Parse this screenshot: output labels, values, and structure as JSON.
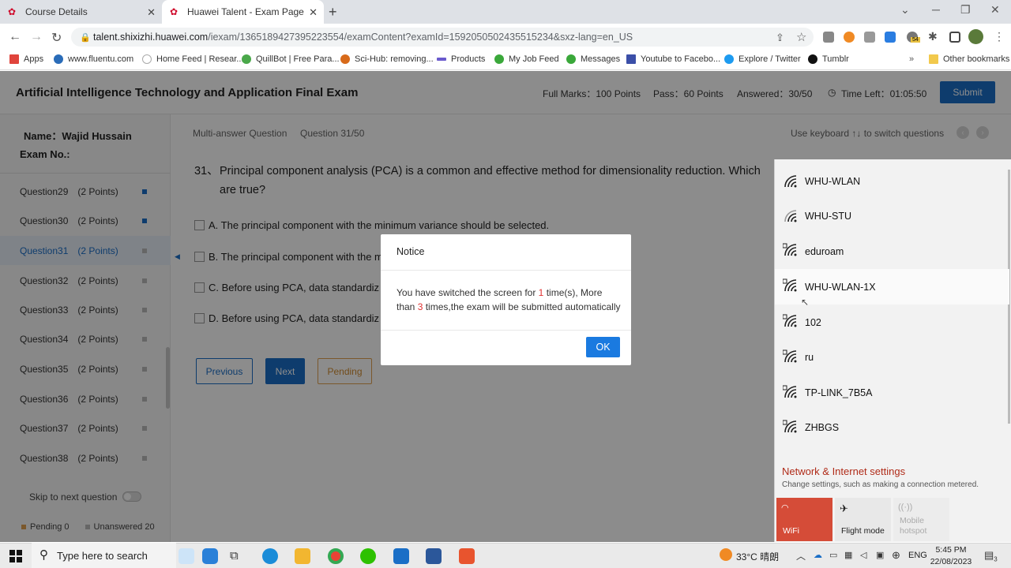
{
  "browser": {
    "tabs": [
      {
        "label": "Course Details",
        "active": false
      },
      {
        "label": "Huawei Talent - Exam Page",
        "active": true
      }
    ],
    "url_host": "talent.shixizhi.huawei.com",
    "url_path": "/iexam/1365189427395223554/examContent?examId=1592050502435515234&sxz-lang=en_US",
    "bookmarks": [
      "Apps",
      "www.fluentu.com",
      "Home Feed | Resear...",
      "QuillBot | Free Para...",
      "Sci-Hub: removing...",
      "Products",
      "My Job Feed",
      "Messages",
      "Youtube to Facebo...",
      "Explore / Twitter",
      "Tumblr",
      "Other bookmarks"
    ],
    "ext_badge": "54"
  },
  "exam": {
    "title": "Artificial Intelligence Technology and Application Final Exam",
    "full_marks": "Full Marks：100 Points",
    "pass": "Pass：60 Points",
    "answered": "Answered：30/50",
    "time_left": "Time Left：01:05:50",
    "submit": "Submit"
  },
  "sidebar": {
    "name": "Name：Wajid Hussain",
    "exam_no": "Exam No.:",
    "questions": [
      {
        "label": "Question29",
        "points": "(2 Points)",
        "answered": true
      },
      {
        "label": "Question30",
        "points": "(2 Points)",
        "answered": true
      },
      {
        "label": "Question31",
        "points": "(2 Points)",
        "answered": false
      },
      {
        "label": "Question32",
        "points": "(2 Points)",
        "answered": false
      },
      {
        "label": "Question33",
        "points": "(2 Points)",
        "answered": false
      },
      {
        "label": "Question34",
        "points": "(2 Points)",
        "answered": false
      },
      {
        "label": "Question35",
        "points": "(2 Points)",
        "answered": false
      },
      {
        "label": "Question36",
        "points": "(2 Points)",
        "answered": false
      },
      {
        "label": "Question37",
        "points": "(2 Points)",
        "answered": false
      },
      {
        "label": "Question38",
        "points": "(2 Points)",
        "answered": false
      }
    ],
    "skip_label": "Skip to next question",
    "pending": "Pending 0",
    "unanswered": "Unanswered 20"
  },
  "question": {
    "type": "Multi-answer Question",
    "number": "Question 31/50",
    "keyboard_hint": "Use keyboard ↑↓ to switch questions",
    "index": "31、",
    "line1": "Principal component analysis (PCA) is a common and effective method for dimensionality reduction. Which",
    "line2": "are true?",
    "options": [
      "A. The principal component with the minimum variance should be selected.",
      "B. The principal component with the m",
      "C. Before using PCA, data standardiz",
      "D. Before using PCA, data standardiz"
    ],
    "prev": "Previous",
    "next": "Next",
    "pending": "Pending"
  },
  "modal": {
    "title": "Notice",
    "text_a": "You have switched the screen for ",
    "count": "1",
    "text_b": " time(s), More than ",
    "limit": "3",
    "text_c": " times,the exam will be submitted automatically",
    "ok": "OK"
  },
  "wifi": {
    "networks": [
      {
        "name": "WHU-WLAN",
        "secured": false
      },
      {
        "name": "WHU-STU",
        "secured": false
      },
      {
        "name": "eduroam",
        "secured": true
      },
      {
        "name": "WHU-WLAN-1X",
        "secured": true
      },
      {
        "name": "102",
        "secured": true
      },
      {
        "name": "ru",
        "secured": true
      },
      {
        "name": "TP-LINK_7B5A",
        "secured": true
      },
      {
        "name": "ZHBGS",
        "secured": true
      }
    ],
    "settings_title": "Network & Internet settings",
    "settings_sub": "Change settings, such as making a connection metered.",
    "tiles": [
      "WiFi",
      "Flight mode",
      "Mobile hotspot"
    ]
  },
  "taskbar": {
    "search": "Type here to search",
    "weather": "33°C  晴朗",
    "ime": "ENG",
    "time": "5:45 PM",
    "date": "22/08/2023",
    "notif_count": "3"
  },
  "colors": {
    "accent": "#1a6ec6",
    "huawei_red": "#cf0a2c",
    "wifi_tile": "#d54c38"
  }
}
